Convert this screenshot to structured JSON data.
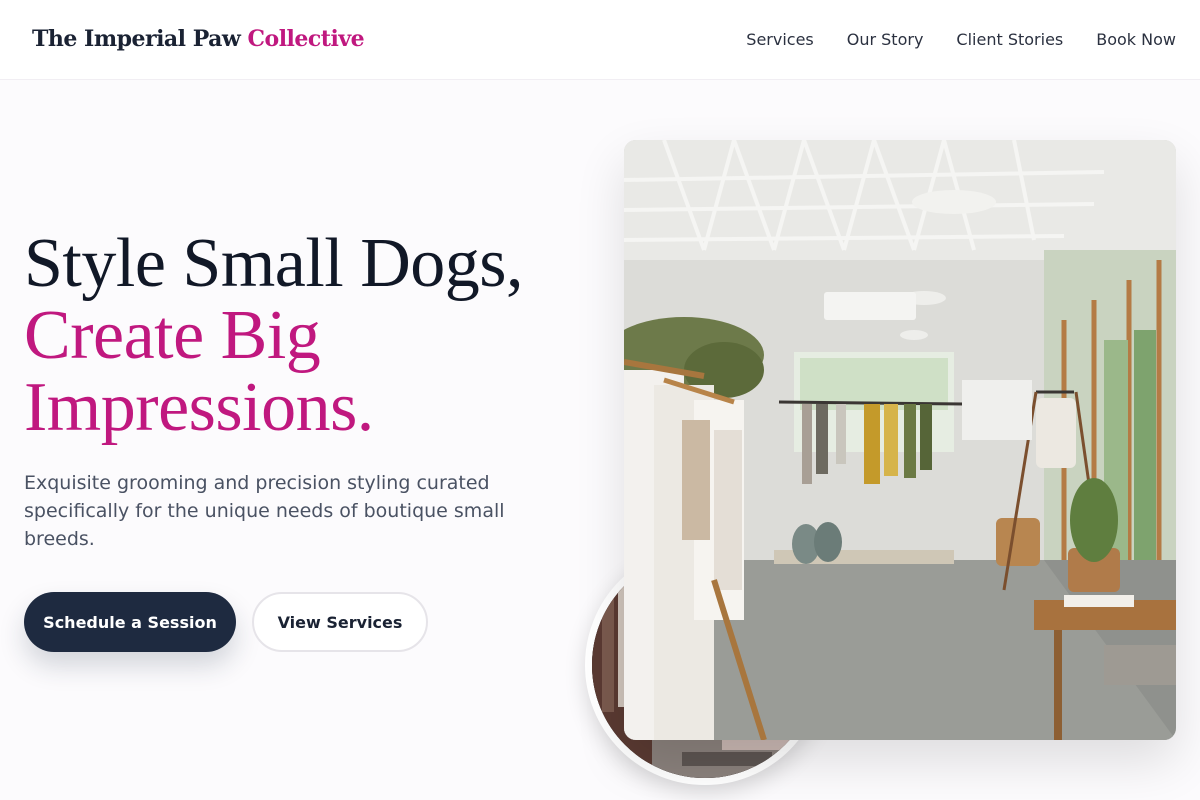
{
  "header": {
    "brand_main": "The Imperial Paw",
    "brand_accent": "Collective",
    "nav": [
      "Services",
      "Our Story",
      "Client Stories",
      "Book Now"
    ]
  },
  "hero": {
    "headline_line1": "Style Small Dogs,",
    "headline_line2": "Create Big",
    "headline_line3": "Impressions.",
    "subtitle": "Exquisite grooming and precision styling curated specifically for the unique needs of boutique small breeds.",
    "primary_cta": "Schedule a Session",
    "secondary_cta": "View Services"
  },
  "colors": {
    "accent": "#c0187f",
    "dark": "#1e2a40",
    "background": "#fcfbfd"
  },
  "images": {
    "main": "boutique-store-interior-photo",
    "secondary": "clothing-rack-circle-photo"
  }
}
